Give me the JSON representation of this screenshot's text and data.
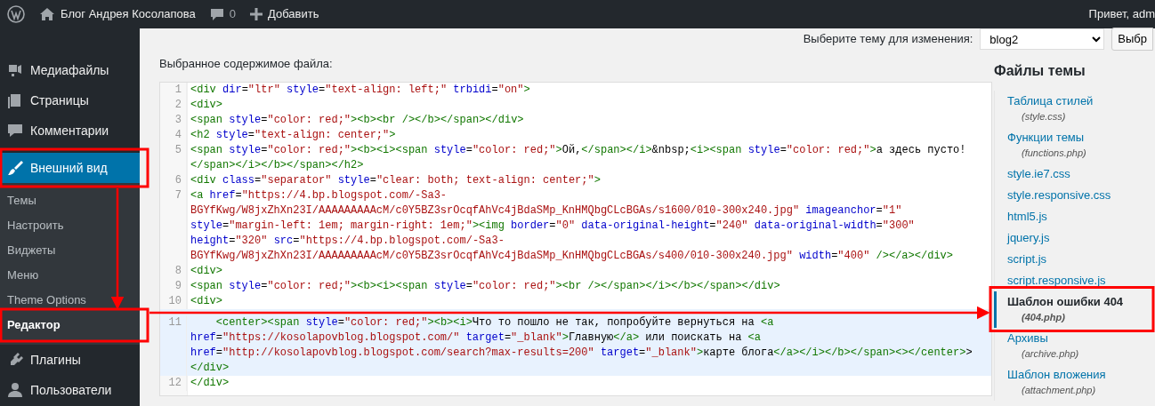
{
  "admin_bar": {
    "site_name": "Блог Андрея Косолапова",
    "comments_count": "0",
    "new_label": "Добавить",
    "greeting": "Привет, adm"
  },
  "sidebar": {
    "items": [
      {
        "label": "Медиафайлы",
        "current": false,
        "annotated": false
      },
      {
        "label": "Страницы",
        "current": false,
        "annotated": false
      },
      {
        "label": "Комментарии",
        "current": false,
        "annotated": false
      },
      {
        "label": "Внешний вид",
        "current": true,
        "annotated": true,
        "children": [
          {
            "label": "Темы",
            "selected": false,
            "annotated": false
          },
          {
            "label": "Настроить",
            "selected": false,
            "annotated": false
          },
          {
            "label": "Виджеты",
            "selected": false,
            "annotated": false
          },
          {
            "label": "Меню",
            "selected": false,
            "annotated": false
          },
          {
            "label": "Theme Options",
            "selected": false,
            "annotated": false
          },
          {
            "label": "Редактор",
            "selected": true,
            "annotated": true
          }
        ]
      },
      {
        "label": "Плагины",
        "current": false,
        "annotated": false
      },
      {
        "label": "Пользователи",
        "current": false,
        "annotated": false
      }
    ]
  },
  "theme_select": {
    "label": "Выберите тему для изменения:",
    "value": "blog2",
    "button": "Выбр"
  },
  "editor": {
    "label": "Выбранное содержимое файла:",
    "lines": [
      {
        "number": "1",
        "code": "<div dir=\"ltr\" style=\"text-align: left;\" trbidi=\"on\">",
        "selected": false
      },
      {
        "number": "2",
        "code": "<div>",
        "selected": false
      },
      {
        "number": "3",
        "code": "<span style=\"color: red;\"><b><br /></b></span></div>",
        "selected": false
      },
      {
        "number": "4",
        "code": "<h2 style=\"text-align: center;\">",
        "selected": false
      },
      {
        "number": "5",
        "code": "<span style=\"color: red;\"><b><i><span style=\"color: red;\">Ой,</span></i>&nbsp;<i><span style=\"color: red;\">а здесь пусто! </span></i></b></span></h2>",
        "selected": false
      },
      {
        "number": "6",
        "code": "<div class=\"separator\" style=\"clear: both; text-align: center;\">",
        "selected": false
      },
      {
        "number": "7",
        "code": "<a href=\"https://4.bp.blogspot.com/-Sa3-BGYfKwg/W8jxZhXn23I/AAAAAAAAAcM/c0Y5BZ3srOcqfAhVc4jBdaSMp_KnHMQbgCLcBGAs/s1600/010-300x240.jpg\" imageanchor=\"1\" style=\"margin-left: 1em; margin-right: 1em;\"><img border=\"0\" data-original-height=\"240\" data-original-width=\"300\" height=\"320\" src=\"https://4.bp.blogspot.com/-Sa3-BGYfKwg/W8jxZhXn23I/AAAAAAAAAcM/c0Y5BZ3srOcqfAhVc4jBdaSMp_KnHMQbgCLcBGAs/s400/010-300x240.jpg\" width=\"400\" /></a></div>",
        "selected": false
      },
      {
        "number": "8",
        "code": "<div>",
        "selected": false
      },
      {
        "number": "9",
        "code": "<span style=\"color: red;\"><b><i><span style=\"color: red;\"><br /></span></i></b></span></div>",
        "selected": false
      },
      {
        "number": "10",
        "code": "<div>",
        "selected": false
      },
      {
        "number": "11",
        "code": "    <center><span style=\"color: red;\"><b><i>Что то пошло не так, попробуйте вернуться на <a href=\"https://kosolapovblog.blogspot.com/\" target=\"_blank\">Главную</a> или поискать на <a href=\"http://kosolapovblog.blogspot.com/search?max-results=200\" target=\"_blank\">карте блога</a></i></b></span><></center>> </div>",
        "selected": true
      },
      {
        "number": "12",
        "code": "</div>",
        "selected": false
      }
    ]
  },
  "theme_files": {
    "title": "Файлы темы",
    "files": [
      {
        "label": "Таблица стилей",
        "filename": "(style.css)",
        "selected": false,
        "annotated": false
      },
      {
        "label": "Функции темы",
        "filename": "(functions.php)",
        "selected": false,
        "annotated": false
      },
      {
        "label": "style.ie7.css",
        "selected": false,
        "annotated": false
      },
      {
        "label": "style.responsive.css",
        "selected": false,
        "annotated": false
      },
      {
        "label": "html5.js",
        "selected": false,
        "annotated": false
      },
      {
        "label": "jquery.js",
        "selected": false,
        "annotated": false
      },
      {
        "label": "script.js",
        "selected": false,
        "annotated": false
      },
      {
        "label": "script.responsive.js",
        "selected": false,
        "annotated": false
      },
      {
        "label": "Шаблон ошибки 404",
        "filename": "(404.php)",
        "selected": true,
        "annotated": true
      },
      {
        "label": "Архивы",
        "filename": "(archive.php)",
        "selected": false,
        "annotated": false
      },
      {
        "label": "Шаблон вложения",
        "filename": "(attachment.php)",
        "selected": false,
        "annotated": false
      }
    ]
  }
}
